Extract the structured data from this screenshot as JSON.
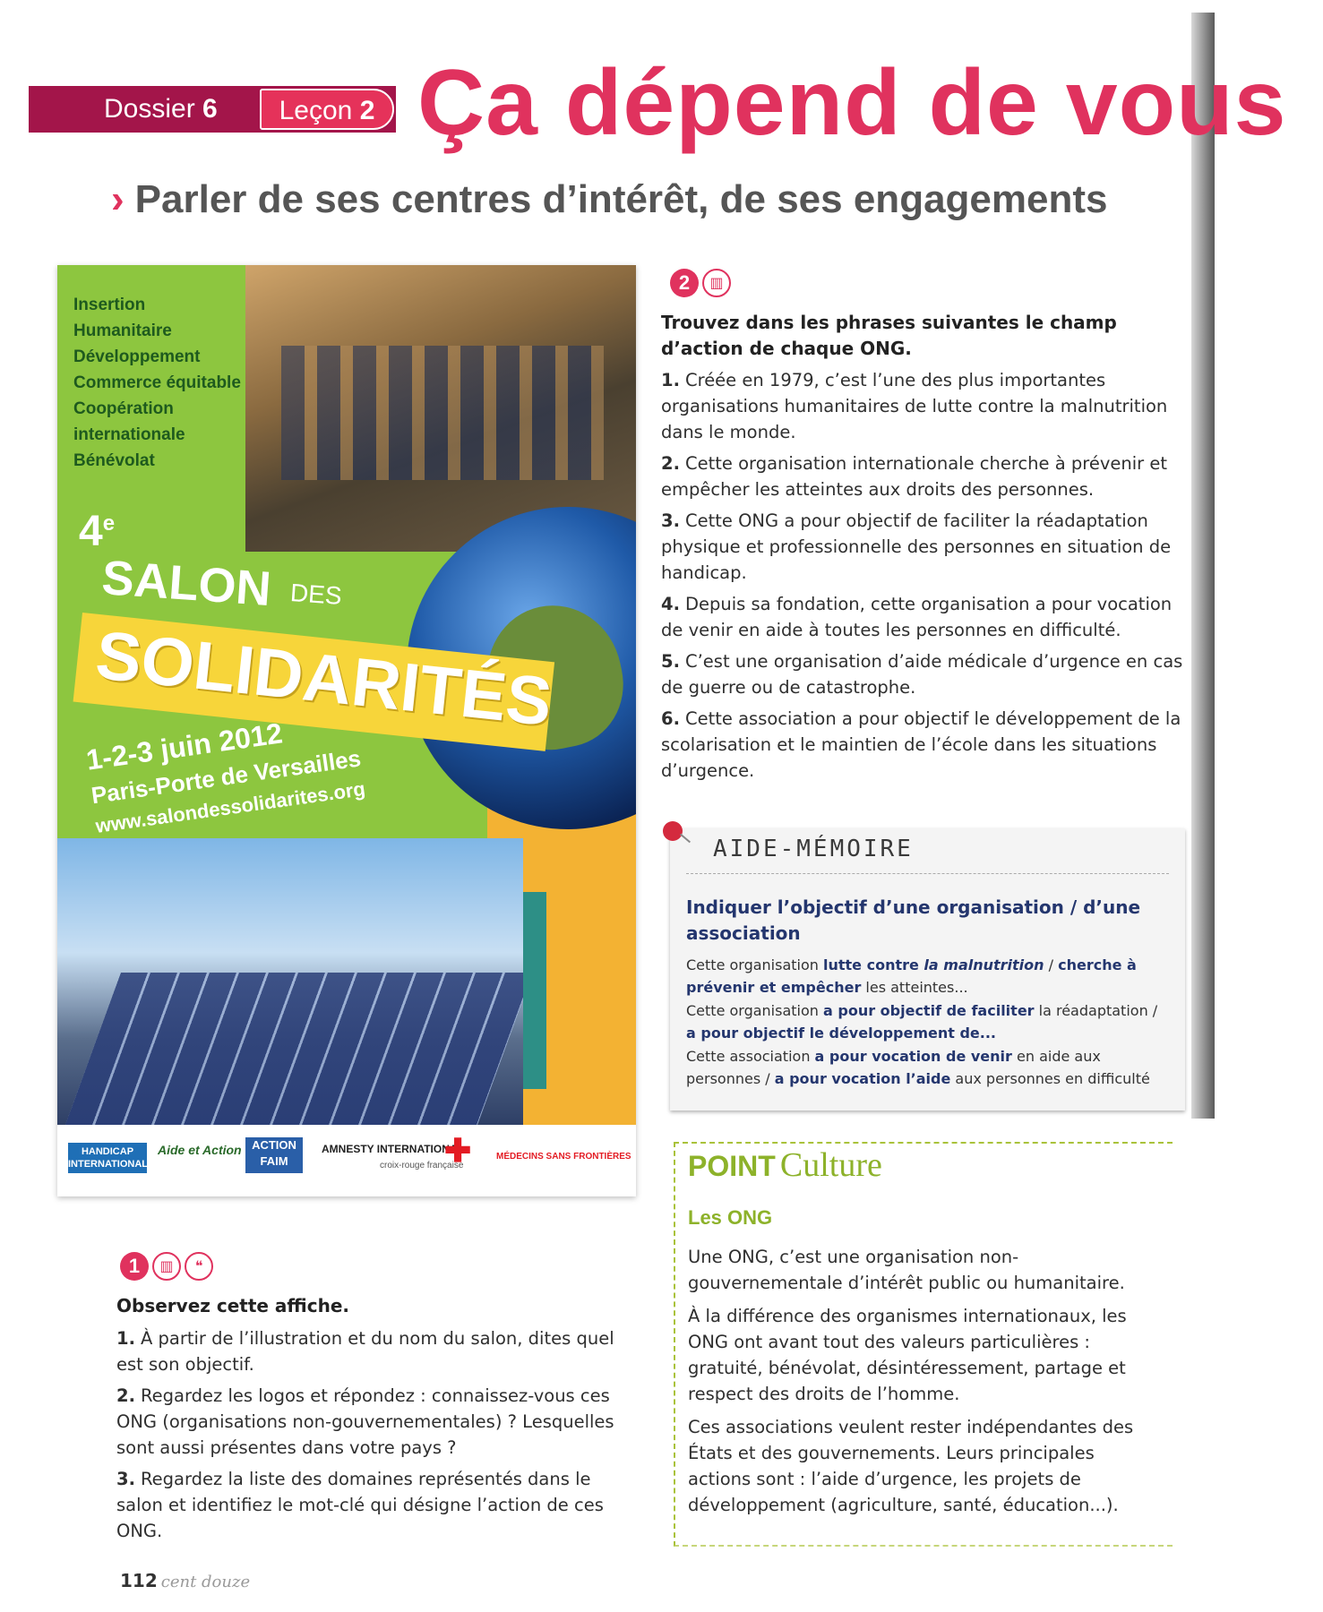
{
  "header": {
    "dossier_label": "Dossier",
    "dossier_num": "6",
    "lecon_label": "Leçon",
    "lecon_num": "2",
    "title": "Ça dépend de vous",
    "subtitle": "Parler de ses centres d’intérêt, de ses engagements",
    "colors": {
      "accent": "#e0325e",
      "dossier_bar": "#a3154a"
    }
  },
  "poster": {
    "domains": [
      "Insertion",
      "Humanitaire",
      "Développement",
      "Commerce équitable",
      "Coopération",
      "internationale",
      "Bénévolat"
    ],
    "edition": "4",
    "edition_sup": "e",
    "salon": "SALON",
    "des": "DES",
    "solidarites": "SOLIDARITÉS",
    "dates": "1-2-3 juin 2012",
    "place": "Paris-Porte de Versailles",
    "website": "www.salondessolidarites.org",
    "logos": {
      "handicap": "HANDICAP INTERNATIONAL",
      "aide_action": "Aide et Action",
      "action_faim": "ACTION FAIM",
      "amnesty": "AMNESTY INTERNATIONAL",
      "croix_rouge": "croix-rouge française",
      "msf": "MÉDECINS SANS FRONTIÈRES"
    }
  },
  "exercise2": {
    "number": "2",
    "title": "Trouvez dans les phrases suivantes le champ d’action de chaque ONG.",
    "items": [
      {
        "n": "1.",
        "text": "Créée en 1979, c’est l’une des plus importantes organisations humanitaires de lutte contre la malnutrition dans le monde."
      },
      {
        "n": "2.",
        "text": "Cette organisation internationale cherche à prévenir et empêcher les atteintes aux droits des personnes."
      },
      {
        "n": "3.",
        "text": "Cette ONG a pour objectif de faciliter la réadaptation physique et professionnelle des personnes en situation de handicap."
      },
      {
        "n": "4.",
        "text": "Depuis sa fondation, cette organisation a pour vocation de venir en aide à toutes les personnes en difficulté."
      },
      {
        "n": "5.",
        "text": "C’est une organisation d’aide médicale d’urgence en cas de guerre ou de catastrophe."
      },
      {
        "n": "6.",
        "text": "Cette association a pour objectif le développement de la scolarisation et le maintien de l’école dans les situations d’urgence."
      }
    ]
  },
  "aide_memoire": {
    "label": "AIDE-MÉMOIRE",
    "heading": "Indiquer l’objectif d’une organisation / d’une association",
    "l1_a": "Cette organisation ",
    "l1_b": "lutte contre ",
    "l1_c": "la malnutrition",
    "l1_d": " / ",
    "l1_e": "cherche à prévenir et empêcher",
    "l1_f": " les atteintes...",
    "l2_a": "Cette organisation ",
    "l2_b": "a pour objectif de faciliter",
    "l2_c": " la réadaptation / ",
    "l2_d": "a pour objectif le développement de...",
    "l3_a": "Cette association ",
    "l3_b": "a pour vocation de venir",
    "l3_c": " en aide aux personnes / ",
    "l3_d": "a pour vocation l’aide",
    "l3_e": " aux personnes en difficulté"
  },
  "exercise1": {
    "number": "1",
    "title": "Observez cette affiche.",
    "items": [
      {
        "n": "1.",
        "text": "À partir de l’illustration et du nom du salon, dites quel est son objectif."
      },
      {
        "n": "2.",
        "text": "Regardez les logos et répondez : connaissez-vous ces ONG (organisations non-gouvernementales) ? Lesquelles sont aussi présentes dans votre pays ?"
      },
      {
        "n": "3.",
        "text": "Regardez la liste des domaines représentés dans le salon et identifiez le mot-clé qui désigne l’action de ces ONG."
      }
    ]
  },
  "point_culture": {
    "point": "POINT",
    "culture": "Culture",
    "subtitle": "Les ONG",
    "paragraphs": [
      "Une ONG, c’est une organisation non-gouvernementale d’intérêt public ou humanitaire.",
      "À la différence des organismes internationaux, les ONG ont avant tout des valeurs particulières : gratuité, bénévolat, désintéressement, partage et respect des droits de l’homme.",
      "Ces associations veulent rester indépendantes des États et des gouvernements. Leurs principales actions sont : l’aide d’urgence, les projets de développement (agriculture, santé, éducation...)."
    ]
  },
  "footer": {
    "page_number": "112",
    "page_words": "cent douze"
  }
}
